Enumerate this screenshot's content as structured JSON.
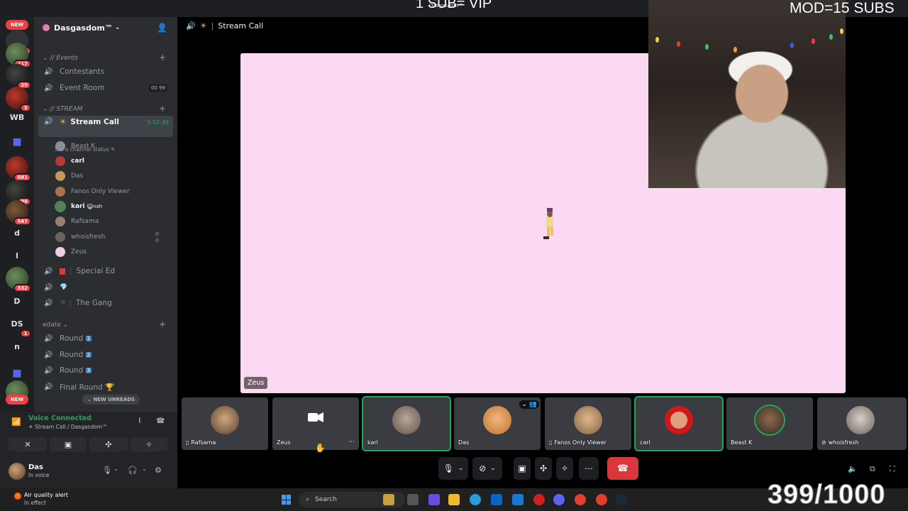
{
  "colors": {
    "accent_green": "#23a55a",
    "danger_red": "#da373c",
    "stage_pink": "#fbd9f2",
    "badge_red": "#f23f43"
  },
  "overlays": {
    "top_title": "1 SUB= VIP",
    "top_small": "Dasgasdom™",
    "mod": "MOD=15 SUBS",
    "count": "399/1000"
  },
  "rail": {
    "new_label": "NEW",
    "servers": [
      {
        "text": "",
        "badge": "5"
      },
      {
        "text": "",
        "badge": "217"
      },
      {
        "text": "",
        "badge": "29"
      },
      {
        "text": "",
        "badge": "3"
      },
      {
        "text": "WB",
        "badge": ""
      },
      {
        "text": "",
        "badge": ""
      },
      {
        "text": "",
        "badge": "681"
      },
      {
        "text": "",
        "badge": "98"
      },
      {
        "text": "",
        "badge": "547"
      },
      {
        "text": "d",
        "badge": ""
      },
      {
        "text": "l",
        "badge": ""
      },
      {
        "text": "",
        "badge": "332"
      },
      {
        "text": "D",
        "badge": ""
      },
      {
        "text": "DS",
        "badge": "1"
      },
      {
        "text": "n",
        "badge": ""
      },
      {
        "text": "",
        "badge": ""
      },
      {
        "text": "",
        "badge": ""
      }
    ],
    "new_label_bottom": "NEW"
  },
  "sidebar": {
    "server_name": "Dasgasdom™",
    "cat_events": "// Events",
    "ch_contestants": "Contestants",
    "ch_event_room": "Event Room",
    "event_room_counter": "00 99",
    "cat_stream": "// STREAM",
    "ch_stream_call": "Stream Call",
    "stream_call_time": "5:02:49",
    "set_status": "Set a channel status",
    "members": [
      {
        "name": "Beast K",
        "extra": ""
      },
      {
        "name": "carl",
        "extra": ""
      },
      {
        "name": "Das",
        "extra": ""
      },
      {
        "name": "Fanos Only Viewer",
        "extra": ""
      },
      {
        "name": "kari",
        "extra": "nah"
      },
      {
        "name": "Rafsama",
        "extra": ""
      },
      {
        "name": "whoisfresh",
        "extra": ""
      },
      {
        "name": "Zeus",
        "extra": ""
      }
    ],
    "ch_special_ed": "Special Ed",
    "ch_gem": "💎",
    "ch_the_gang": "The Gang",
    "cat_edate": "edate",
    "ch_round1": "Round",
    "ch_round2": "Round",
    "ch_round3": "Round",
    "round1_num": "1",
    "round2_num": "2",
    "round3_num": "3",
    "ch_final_round": "Final Round 🏆",
    "new_unreads": "NEW UNREADS"
  },
  "voice": {
    "title": "Voice Connected",
    "subtitle": "Stream Call / Dasgasdom™"
  },
  "user": {
    "name": "Das",
    "status": "In voice"
  },
  "call": {
    "header": "Stream Call",
    "stage_name": "Zeus",
    "tiles": [
      {
        "name": "Rafsama"
      },
      {
        "name": "Zeus"
      },
      {
        "name": "kari"
      },
      {
        "name": "Das"
      },
      {
        "name": "Fanos Only Viewer"
      },
      {
        "name": "carl"
      },
      {
        "name": "Beast K"
      },
      {
        "name": "whoisfresh"
      }
    ]
  },
  "taskbar": {
    "alert_title": "Air quality alert",
    "alert_sub": "In effect",
    "search_placeholder": "Search"
  }
}
